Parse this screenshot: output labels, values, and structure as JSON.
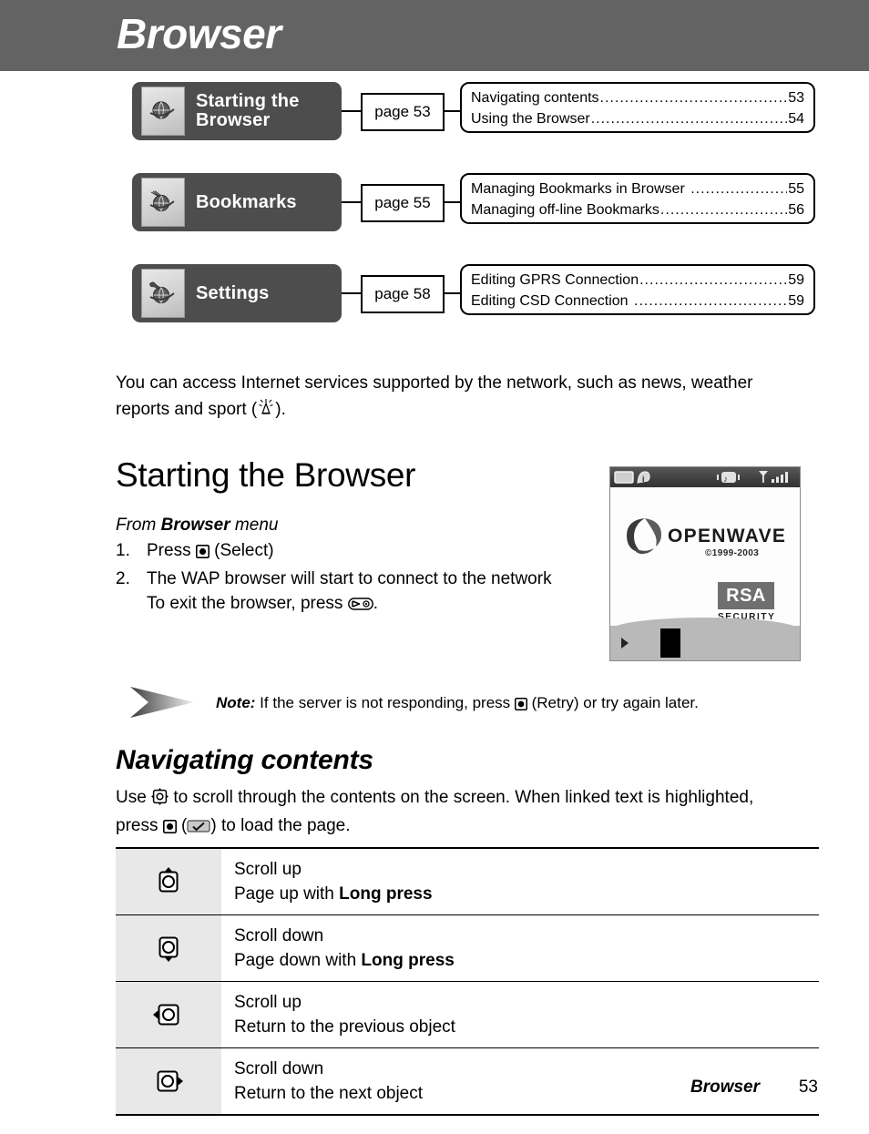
{
  "header": {
    "title": "Browser"
  },
  "navmap": {
    "rows": [
      {
        "chapter": "Starting the\nBrowser",
        "chapter_label": "Starting the Browser",
        "icon": "globe-icon",
        "page_ref": "page 53",
        "contents": [
          {
            "title": "Navigating contents",
            "page": "53"
          },
          {
            "title": "Using the Browser",
            "page": "54"
          }
        ]
      },
      {
        "chapter": "Bookmarks",
        "chapter_label": "Bookmarks",
        "icon": "globe-bookmark-icon",
        "page_ref": "page 55",
        "contents": [
          {
            "title": "Managing Bookmarks in Browser",
            "page": "55"
          },
          {
            "title": "Managing off-line Bookmarks",
            "page": "56"
          }
        ]
      },
      {
        "chapter": "Settings",
        "chapter_label": "Settings",
        "icon": "globe-wrench-icon",
        "page_ref": "page 58",
        "contents": [
          {
            "title": "Editing GPRS Connection",
            "page": "59"
          },
          {
            "title": "Editing CSD Connection",
            "page": "59"
          }
        ]
      }
    ]
  },
  "intro": {
    "part1": "You can access Internet services supported by the network, such as news, weather reports and sport (",
    "part2": ").",
    "icon": "antenna-tower-icon"
  },
  "section": {
    "heading": "Starting the Browser",
    "from_prefix": "From ",
    "from_bold": "Browser",
    "from_suffix": " menu",
    "steps": [
      {
        "num": "1.",
        "before": "Press ",
        "key": "select-key-icon",
        "after": " (Select)"
      },
      {
        "num": "2.",
        "before": "The WAP browser will start to connect to the network",
        "key": "",
        "after": ""
      }
    ],
    "exit_before": "To exit the browser, press ",
    "exit_key": "end-call-key-icon",
    "exit_after": "."
  },
  "phone_screen": {
    "brand": "OPENWAVE",
    "copyright": "©1999-2003",
    "rsa": "RSA",
    "rsa_sub": "SECURITY",
    "status_icons": [
      "battery-icon",
      "info-icon",
      "vibrate-icon",
      "signal-icon"
    ],
    "softkey_icon": "play-triangle-icon"
  },
  "note": {
    "label": "Note:",
    "text": " If the server is not responding, press ",
    "key": "select-key-icon",
    "text2": " (Retry) or try again later.",
    "icon": "note-arrow-icon"
  },
  "subsection": {
    "heading": "Navigating contents",
    "use_before": "Use ",
    "nav_key": "navigation-key-icon",
    "use_mid": " to scroll through the contents on the screen. When linked text is highlighted, press ",
    "select_key": "select-key-icon",
    "use_mid2": " (",
    "check_key": "check-softkey-icon",
    "use_after": ") to load the page."
  },
  "key_table": {
    "rows": [
      {
        "icon": "up-key-icon",
        "line1": "Scroll up",
        "line2_plain": "Page up with ",
        "line2_bold": "Long press",
        "line2_tail": ""
      },
      {
        "icon": "down-key-icon",
        "line1": "Scroll down",
        "line2_plain": "Page down with ",
        "line2_bold": "Long press",
        "line2_tail": ""
      },
      {
        "icon": "left-key-icon",
        "line1": "Scroll up",
        "line2_plain": "Return to the previous object",
        "line2_bold": "",
        "line2_tail": ""
      },
      {
        "icon": "right-key-icon",
        "line1": "Scroll down",
        "line2_plain": "Return to the next object",
        "line2_bold": "",
        "line2_tail": ""
      }
    ]
  },
  "footer": {
    "name": "Browser",
    "page": "53"
  },
  "colors": {
    "header_bar": "#636363",
    "chapter_box": "#4d4d4d",
    "table_icon_cell": "#e8e8e8",
    "rsa_badge": "#6f6f6f"
  }
}
